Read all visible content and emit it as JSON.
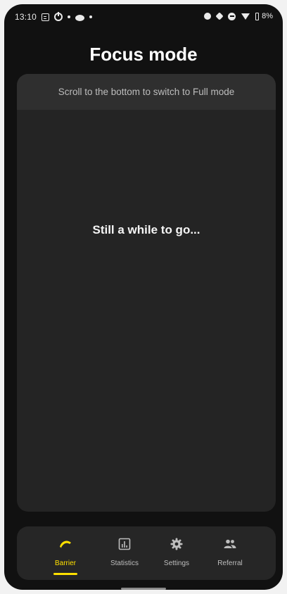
{
  "status_bar": {
    "time": "13:10",
    "battery_text": "8%",
    "left_icons": [
      "notes-icon",
      "power-icon",
      "dot-icon",
      "reddit-icon",
      "dot-icon"
    ],
    "right_icons": [
      "alarm-icon",
      "vibrate-icon",
      "dnd-icon",
      "wifi-icon",
      "battery-icon"
    ]
  },
  "header": {
    "title": "Focus mode"
  },
  "content": {
    "hint": "Scroll to the bottom to switch to Full mode",
    "message": "Still a while to go..."
  },
  "bottom_nav": {
    "active_color": "#ffe000",
    "items": [
      {
        "label": "Barrier",
        "icon": "barrier-icon",
        "active": true
      },
      {
        "label": "Statistics",
        "icon": "statistics-icon",
        "active": false
      },
      {
        "label": "Settings",
        "icon": "settings-icon",
        "active": false
      },
      {
        "label": "Referral",
        "icon": "referral-icon",
        "active": false
      }
    ]
  }
}
